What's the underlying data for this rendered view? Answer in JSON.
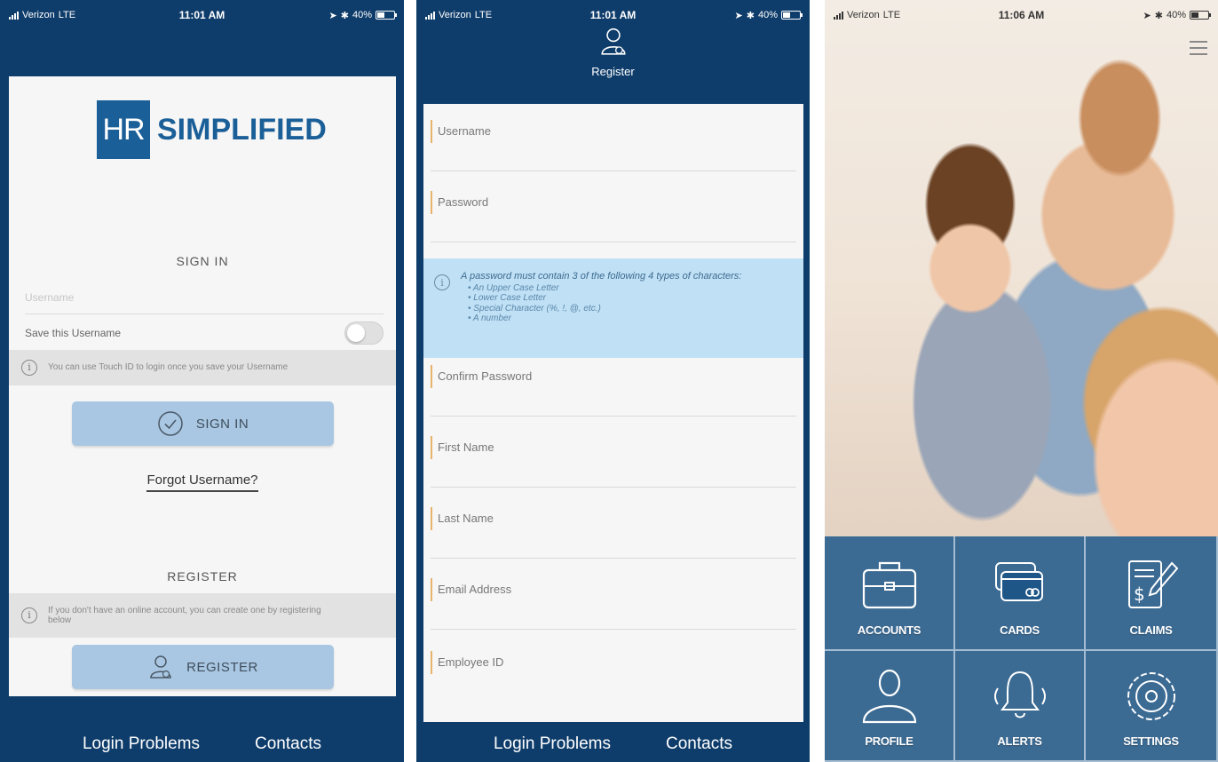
{
  "status_bar": {
    "carrier": "Verizon",
    "network": "LTE",
    "battery": "40%",
    "time_screen1": "11:01 AM",
    "time_screen2": "11:01 AM",
    "time_screen3": "11:06 AM"
  },
  "login_screen": {
    "logo": {
      "mark": "HR",
      "word": "SIMPLIFIED"
    },
    "sign_in_heading": "SIGN IN",
    "username_placeholder": "Username",
    "save_username_label": "Save this Username",
    "save_username_on": false,
    "touch_id_info": "You can use Touch ID to login once you save your Username",
    "sign_in_button": "SIGN IN",
    "forgot_link": "Forgot Username?",
    "register_heading": "REGISTER",
    "register_info": "If you don't have an online account, you can create one by registering below",
    "register_button": "REGISTER",
    "footer": {
      "login_problems": "Login Problems",
      "contacts": "Contacts"
    }
  },
  "register_screen": {
    "title": "Register",
    "fields": {
      "username": "Username",
      "password": "Password",
      "confirm_password": "Confirm Password",
      "first_name": "First Name",
      "last_name": "Last Name",
      "email": "Email Address",
      "employee_id": "Employee ID"
    },
    "password_rules": {
      "intro": "A password must contain 3 of the following 4 types of characters:",
      "items": [
        "An Upper Case Letter",
        "Lower Case Letter",
        "Special Character (%, !, @, etc.)",
        "A number"
      ]
    },
    "footer": {
      "login_problems": "Login Problems",
      "contacts": "Contacts"
    }
  },
  "home_screen": {
    "tiles": [
      "ACCOUNTS",
      "CARDS",
      "CLAIMS",
      "PROFILE",
      "ALERTS",
      "SETTINGS"
    ],
    "tile_icons": [
      "briefcase-icon",
      "cards-icon",
      "claims-document-icon",
      "profile-person-icon",
      "bell-icon",
      "gear-icon"
    ]
  },
  "colors": {
    "navy": "#0f3d6b",
    "brand_blue": "#1b5f98",
    "button_blue": "#a9c7e2",
    "info_blue": "#bfe0f5",
    "field_accent": "#e8b36a"
  }
}
